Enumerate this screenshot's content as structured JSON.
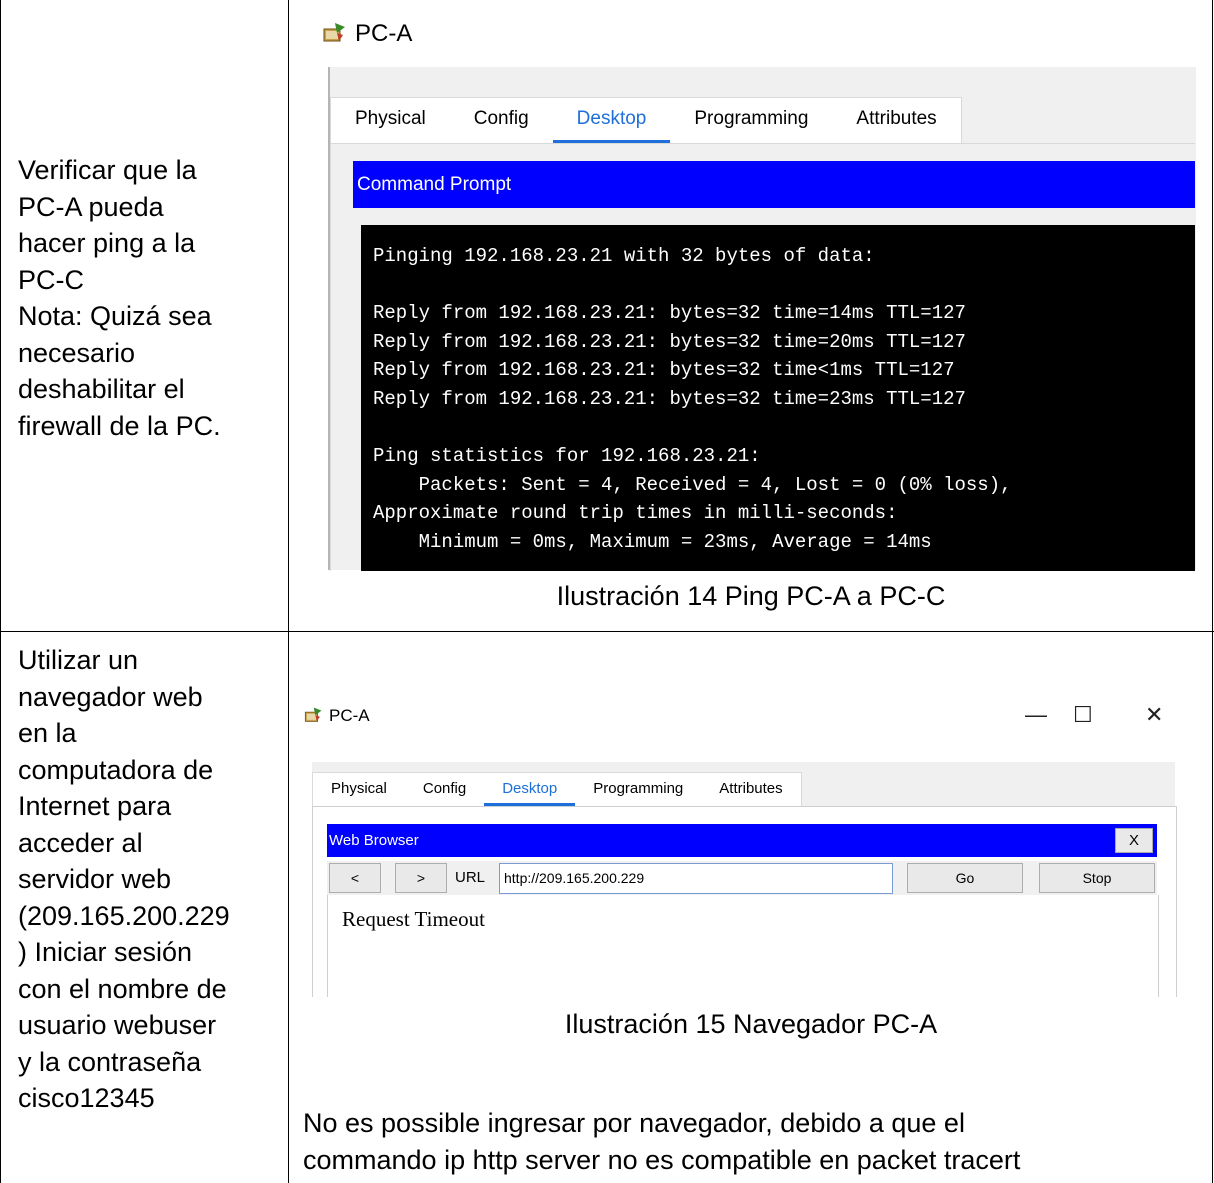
{
  "rows": [
    {
      "instruction": "Verificar que la\nPC-A pueda\nhacer ping a la\nPC-C\nNota: Quizá sea\nnecesario\ndeshabilitar el\nfirewall de la PC.",
      "window": {
        "title": "PC-A",
        "tabs": [
          "Physical",
          "Config",
          "Desktop",
          "Programming",
          "Attributes"
        ],
        "active_tab": "Desktop",
        "panel_title": "Command Prompt",
        "console_text": "Pinging 192.168.23.21 with 32 bytes of data:\n\nReply from 192.168.23.21: bytes=32 time=14ms TTL=127\nReply from 192.168.23.21: bytes=32 time=20ms TTL=127\nReply from 192.168.23.21: bytes=32 time<1ms TTL=127\nReply from 192.168.23.21: bytes=32 time=23ms TTL=127\n\nPing statistics for 192.168.23.21:\n    Packets: Sent = 4, Received = 4, Lost = 0 (0% loss),\nApproximate round trip times in milli-seconds:\n    Minimum = 0ms, Maximum = 23ms, Average = 14ms"
      },
      "caption": "Ilustración 14 Ping PC-A a PC-C"
    },
    {
      "instruction": "Utilizar un\nnavegador web\nen la\ncomputadora de\nInternet para\nacceder al\nservidor web\n(209.165.200.229\n) Iniciar sesión\ncon el nombre de\nusuario webuser\ny la contraseña\ncisco12345",
      "window": {
        "title": "PC-A",
        "controls": {
          "minimize": "—",
          "maximize": "☐",
          "close": "✕"
        },
        "tabs": [
          "Physical",
          "Config",
          "Desktop",
          "Programming",
          "Attributes"
        ],
        "active_tab": "Desktop",
        "panel_title": "Web Browser",
        "close_label": "X",
        "back_label": "<",
        "forward_label": ">",
        "url_label": "URL",
        "url_value": "http://209.165.200.229",
        "go_label": "Go",
        "stop_label": "Stop",
        "page_text": "Request Timeout"
      },
      "caption": "Ilustración 15 Navegador PC-A",
      "note": "No es possible ingresar por navegador, debido a que el\ncommando ip http server no es compatible en packet tracert"
    }
  ]
}
